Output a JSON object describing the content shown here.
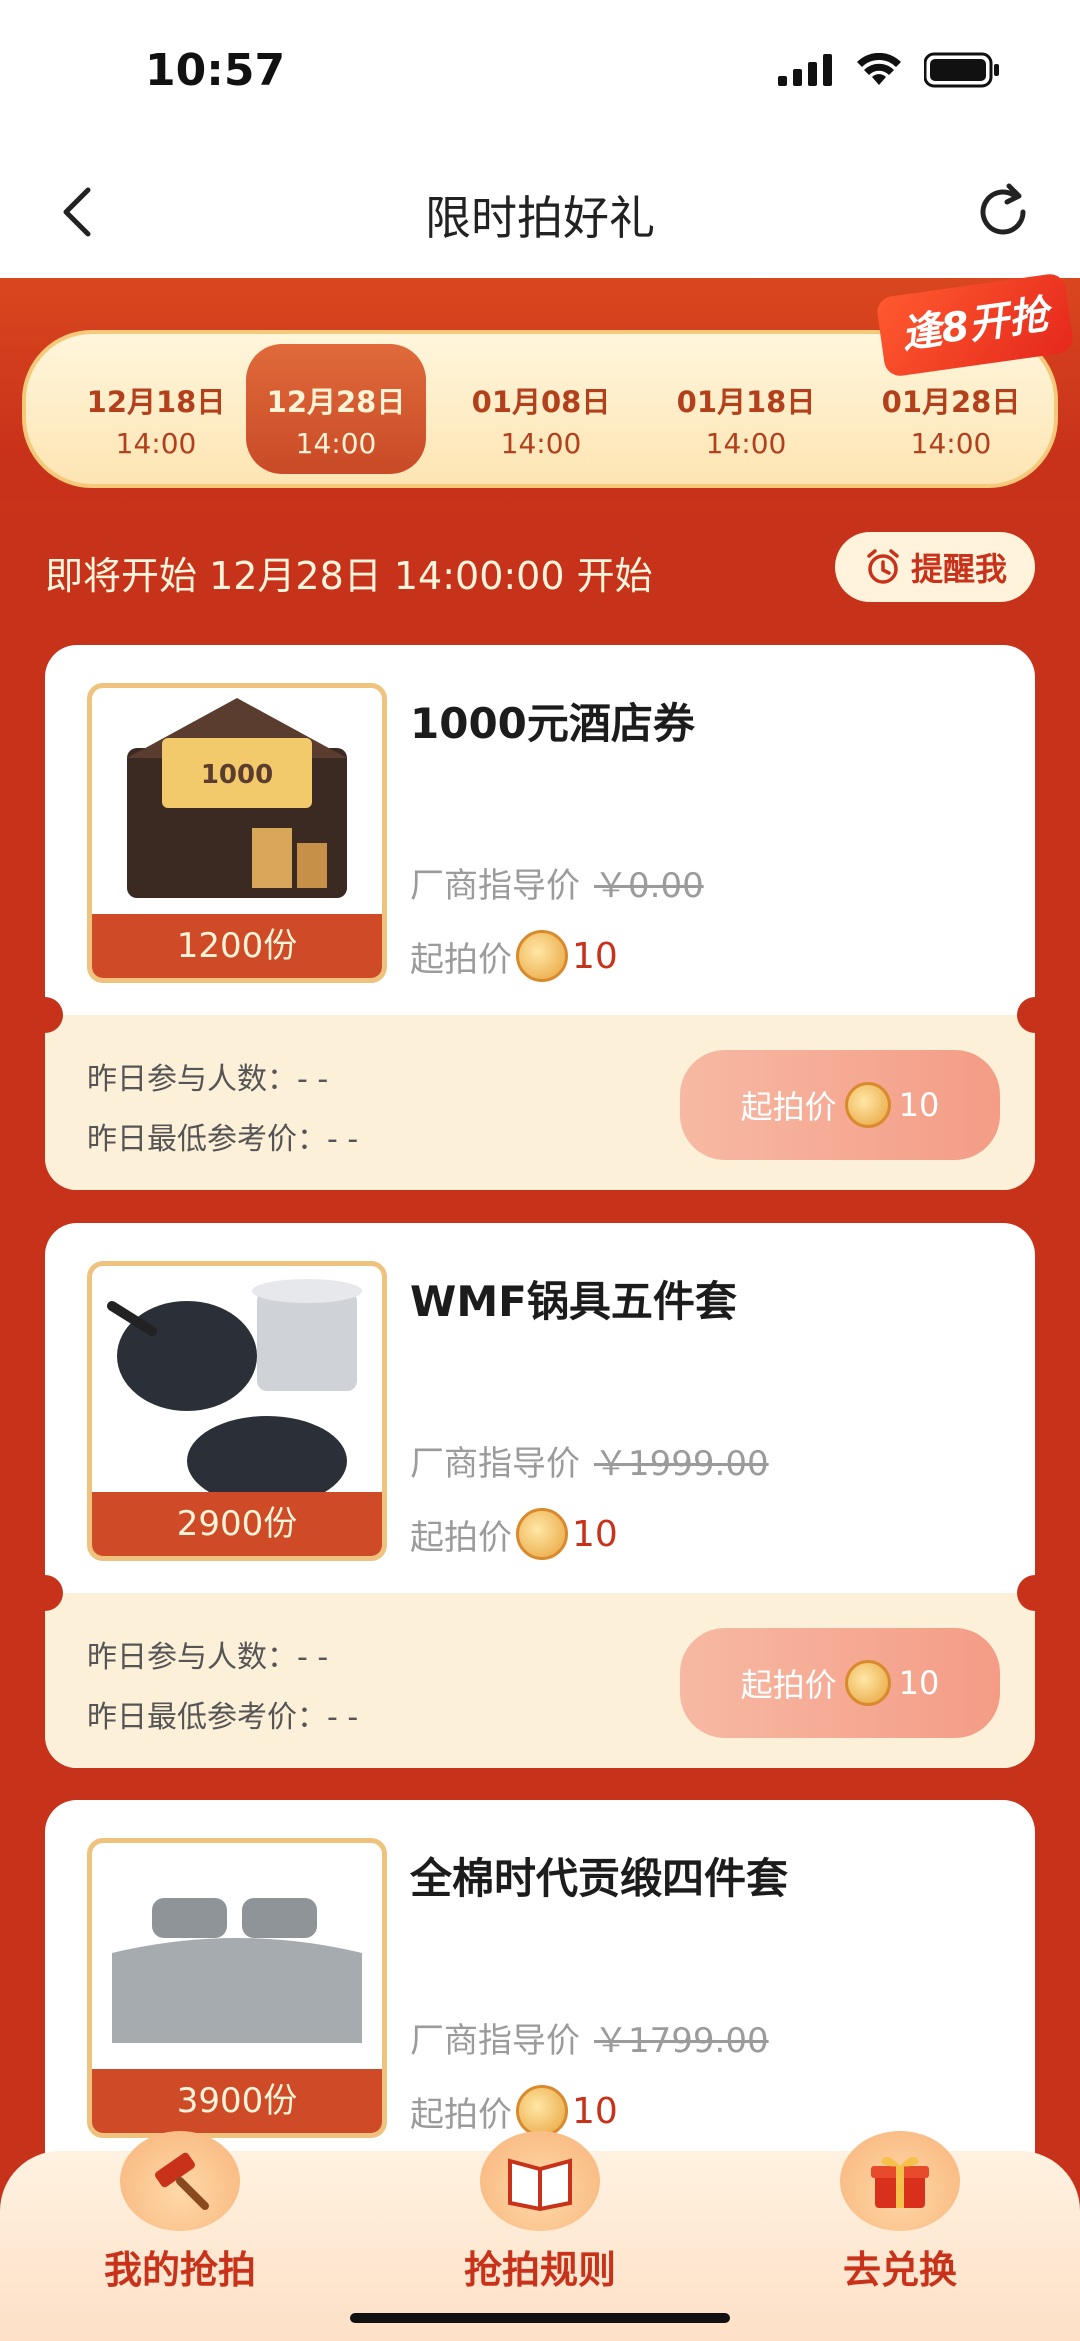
{
  "status_bar": {
    "time": "10:57"
  },
  "nav": {
    "title": "限时拍好礼"
  },
  "schedule": {
    "dates": [
      {
        "date": "12月18日",
        "time": "14:00",
        "active": false
      },
      {
        "date": "12月28日",
        "time": "14:00",
        "active": true
      },
      {
        "date": "01月08日",
        "time": "14:00",
        "active": false
      },
      {
        "date": "01月18日",
        "time": "14:00",
        "active": false
      },
      {
        "date": "01月28日",
        "time": "14:00",
        "active": false
      }
    ],
    "badge": "逢8开抢"
  },
  "upcoming": {
    "text": "即将开始 12月28日 14:00:00 开始",
    "remind_label": "提醒我"
  },
  "products": [
    {
      "name": "1000元酒店券",
      "qty": "1200份",
      "guide_label": "厂商指导价",
      "guide_price": "￥0.00",
      "start_label": "起拍价",
      "start_value": "10",
      "stat1": "昨日参与人数：- -",
      "stat2": "昨日最低参考价：- -",
      "bid_label": "起拍价",
      "bid_value": "10"
    },
    {
      "name": "WMF锅具五件套",
      "qty": "2900份",
      "guide_label": "厂商指导价",
      "guide_price": "￥1999.00",
      "start_label": "起拍价",
      "start_value": "10",
      "stat1": "昨日参与人数：- -",
      "stat2": "昨日最低参考价：- -",
      "bid_label": "起拍价",
      "bid_value": "10"
    },
    {
      "name": "全棉时代贡缎四件套",
      "qty": "3900份",
      "guide_label": "厂商指导价",
      "guide_price": "￥1799.00",
      "start_label": "起拍价",
      "start_value": "10"
    }
  ],
  "tabs": [
    {
      "label": "我的抢拍"
    },
    {
      "label": "抢拍规则"
    },
    {
      "label": "去兑换"
    }
  ]
}
